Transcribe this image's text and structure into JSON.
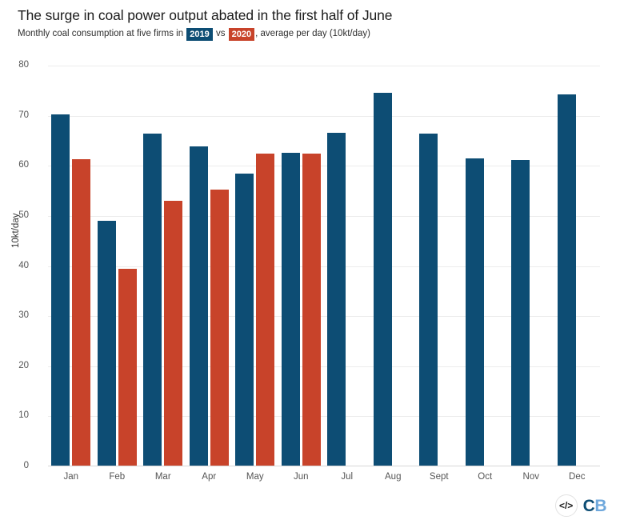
{
  "header": {
    "title": "The surge in coal power output abated in the first half of June",
    "subtitle_part1": "Monthly coal consumption at five firms in ",
    "subtitle_badge1": "2019",
    "subtitle_mid": " vs ",
    "subtitle_badge2": "2020",
    "subtitle_part2": ", average per day (10kt/day)"
  },
  "logo": {
    "embed_icon": "</>",
    "brand_c": "C",
    "brand_b": "B"
  },
  "colors": {
    "series_2019": "#0d4d74",
    "series_2020": "#c8432a",
    "gridline": "#ececec",
    "text": "#2b2b2b",
    "tick_text": "#555555"
  },
  "chart_data": {
    "type": "bar",
    "title": "The surge in coal power output abated in the first half of June",
    "subtitle": "Monthly coal consumption at five firms in 2019 vs 2020, average per day (10kt/day)",
    "xlabel": "",
    "ylabel": "10kt/day",
    "categories": [
      "Jan",
      "Feb",
      "Mar",
      "Apr",
      "May",
      "Jun",
      "Jul",
      "Aug",
      "Sept",
      "Oct",
      "Nov",
      "Dec"
    ],
    "series": [
      {
        "name": "2019",
        "color": "#0d4d74",
        "values": [
          70.3,
          49.1,
          66.5,
          63.8,
          58.5,
          62.6,
          66.6,
          74.6,
          66.5,
          61.5,
          61.2,
          74.3
        ]
      },
      {
        "name": "2020",
        "color": "#c8432a",
        "values": [
          61.3,
          39.4,
          53.0,
          55.3,
          62.5,
          62.4,
          null,
          null,
          null,
          null,
          null,
          null
        ]
      }
    ],
    "ylim": [
      0,
      80
    ],
    "yticks": [
      0,
      10,
      20,
      30,
      40,
      50,
      60,
      70,
      80
    ],
    "ytick_labels": [
      "0",
      "10",
      "20",
      "30",
      "40",
      "50",
      "60",
      "70",
      "80"
    ],
    "grid": true,
    "grid_axis": "y",
    "legend_position": "subtitle-inline",
    "bar_group_mode": "grouped"
  }
}
